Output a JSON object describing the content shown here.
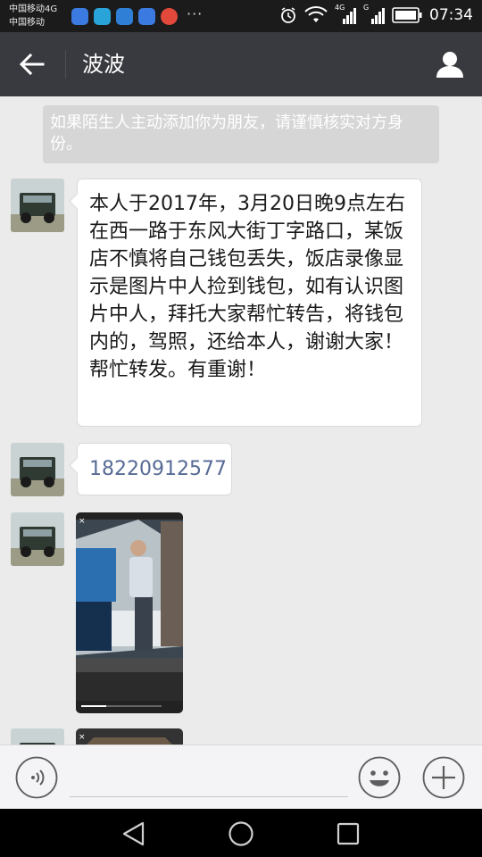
{
  "status_bar": {
    "carrier_line1": "中国移动4G",
    "carrier_line2": "中国移动",
    "notification_more": "···",
    "net_label_1": "4G",
    "net_label_2": "G",
    "time": "07:34"
  },
  "header": {
    "title": "波波"
  },
  "chat": {
    "system_notice": "如果陌生人主动添加你为朋友，请谨慎核实对方身份。",
    "messages": [
      {
        "type": "text",
        "text": "本人于2017年，3月20日晚9点左右在西一路于东风大街丁字路口，某饭店不慎将自己钱包丢失，饭店录像显示是图片中人捡到钱包，如有认识图片中人，拜托大家帮忙转告，将钱包内的，驾照，还给本人，谢谢大家！帮忙转发。有重谢！"
      },
      {
        "type": "link",
        "text": "18220912577"
      },
      {
        "type": "image",
        "caption": ""
      },
      {
        "type": "image",
        "caption": ""
      }
    ]
  },
  "colors": {
    "status_bar": "#1b1b1b",
    "title_bar": "#393a3f",
    "chat_background": "#ebebeb",
    "notice_background": "#d6d6d6",
    "link": "#576b95"
  },
  "icons": {
    "back": "arrow-left-icon",
    "profile": "person-icon",
    "voice": "voice-icon",
    "emoji": "emoji-icon",
    "plus": "plus-icon"
  }
}
